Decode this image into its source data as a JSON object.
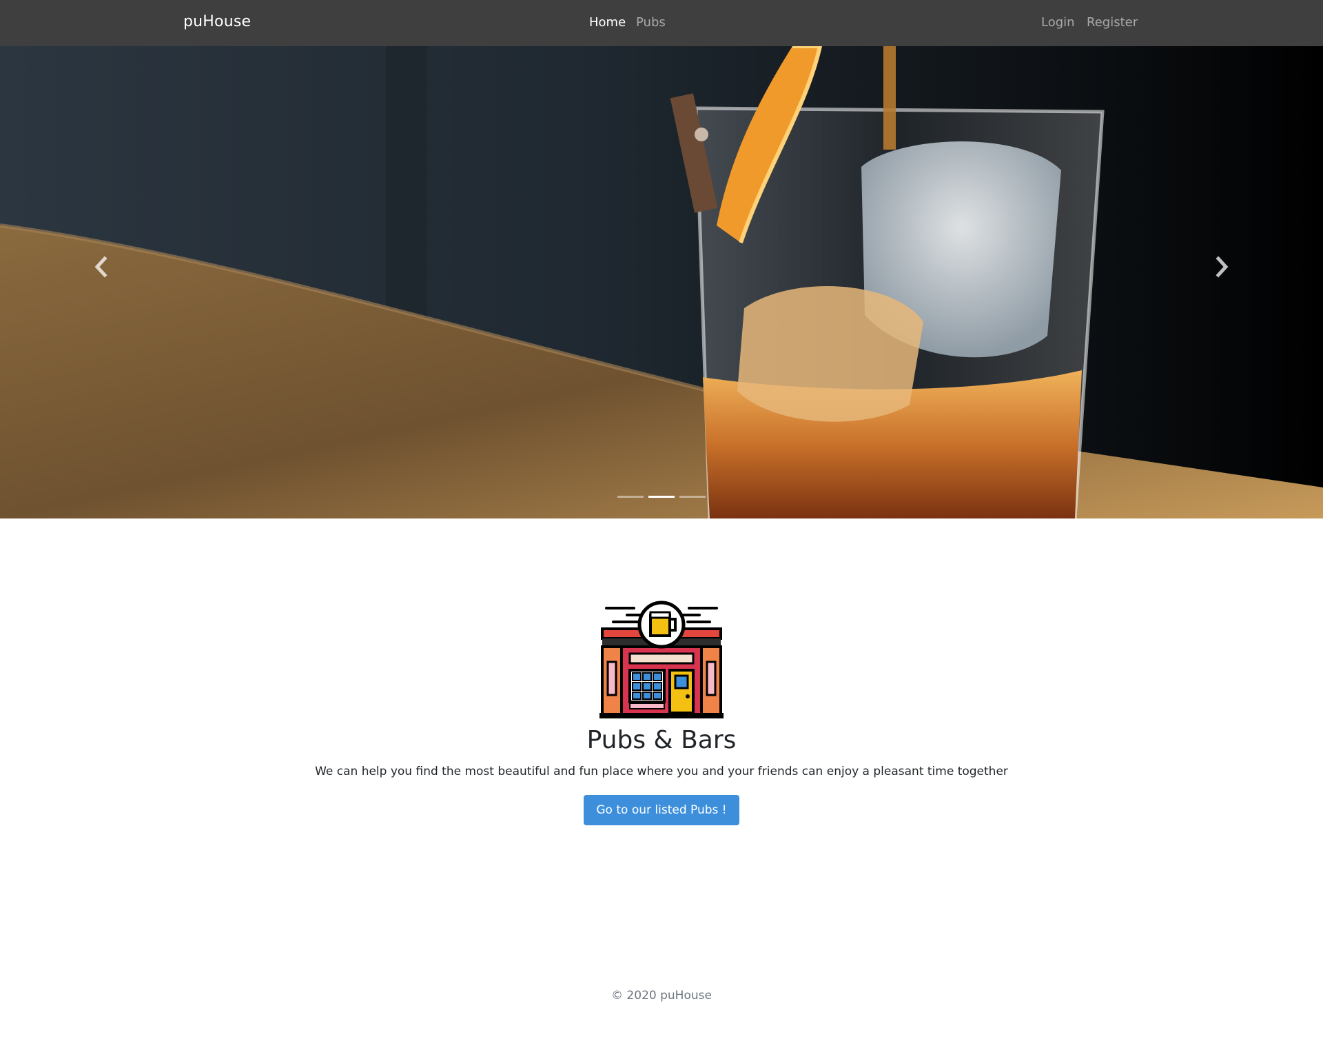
{
  "navbar": {
    "brand": "puHouse",
    "links": [
      {
        "label": "Home",
        "active": true
      },
      {
        "label": "Pubs",
        "active": false
      }
    ],
    "auth": [
      {
        "label": "Login"
      },
      {
        "label": "Register"
      }
    ]
  },
  "carousel": {
    "image_subject": "whiskey glass with ice and orange peel",
    "prev_icon": "chevron-left-icon",
    "next_icon": "chevron-right-icon",
    "slide_count": 3,
    "active_slide": 2
  },
  "feature": {
    "icon": "pub-building-icon",
    "title": "Pubs & Bars",
    "text": "We can help you find the most beautiful and fun place where you and your friends can enjoy a pleasant time together",
    "button_label": "Go to our listed Pubs !"
  },
  "footer": {
    "copyright": "© 2020 puHouse"
  },
  "colors": {
    "navbar_bg": "#3f3f3f",
    "button_bg": "#3d8fdc",
    "footer_text": "#6c757d"
  }
}
